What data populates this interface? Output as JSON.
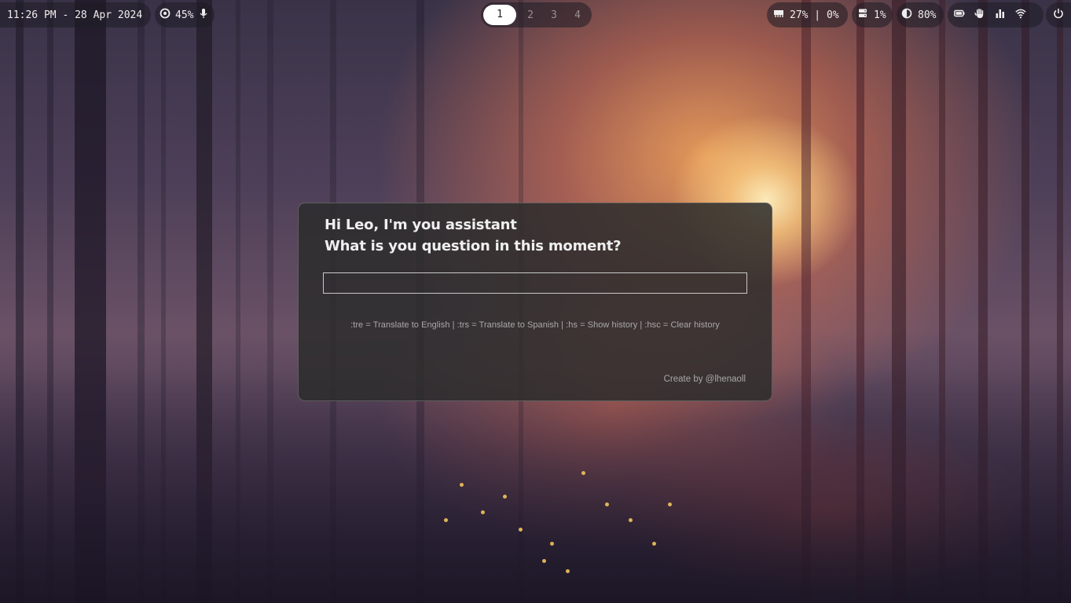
{
  "topbar": {
    "clock": "11:26 PM - 28 Apr 2024",
    "volume": "45%",
    "workspaces": [
      "1",
      "2",
      "3",
      "4"
    ],
    "active_workspace": "1",
    "cpu": "27% | 0%",
    "memory": "1%",
    "brightness": "80%",
    "tray_icons": [
      "battery-icon",
      "hand-icon",
      "bar-chart-icon",
      "wifi-icon"
    ],
    "power_icon": "power-icon"
  },
  "assistant": {
    "greeting_line1": "Hi Leo, I'm you assistant",
    "greeting_line2": "What is you question in this moment?",
    "input_value": "",
    "hints": ":tre = Translate to English | :trs = Translate to Spanish | :hs = Show history | :hsc = Clear history",
    "credit": "Create by @lhenaoll"
  }
}
